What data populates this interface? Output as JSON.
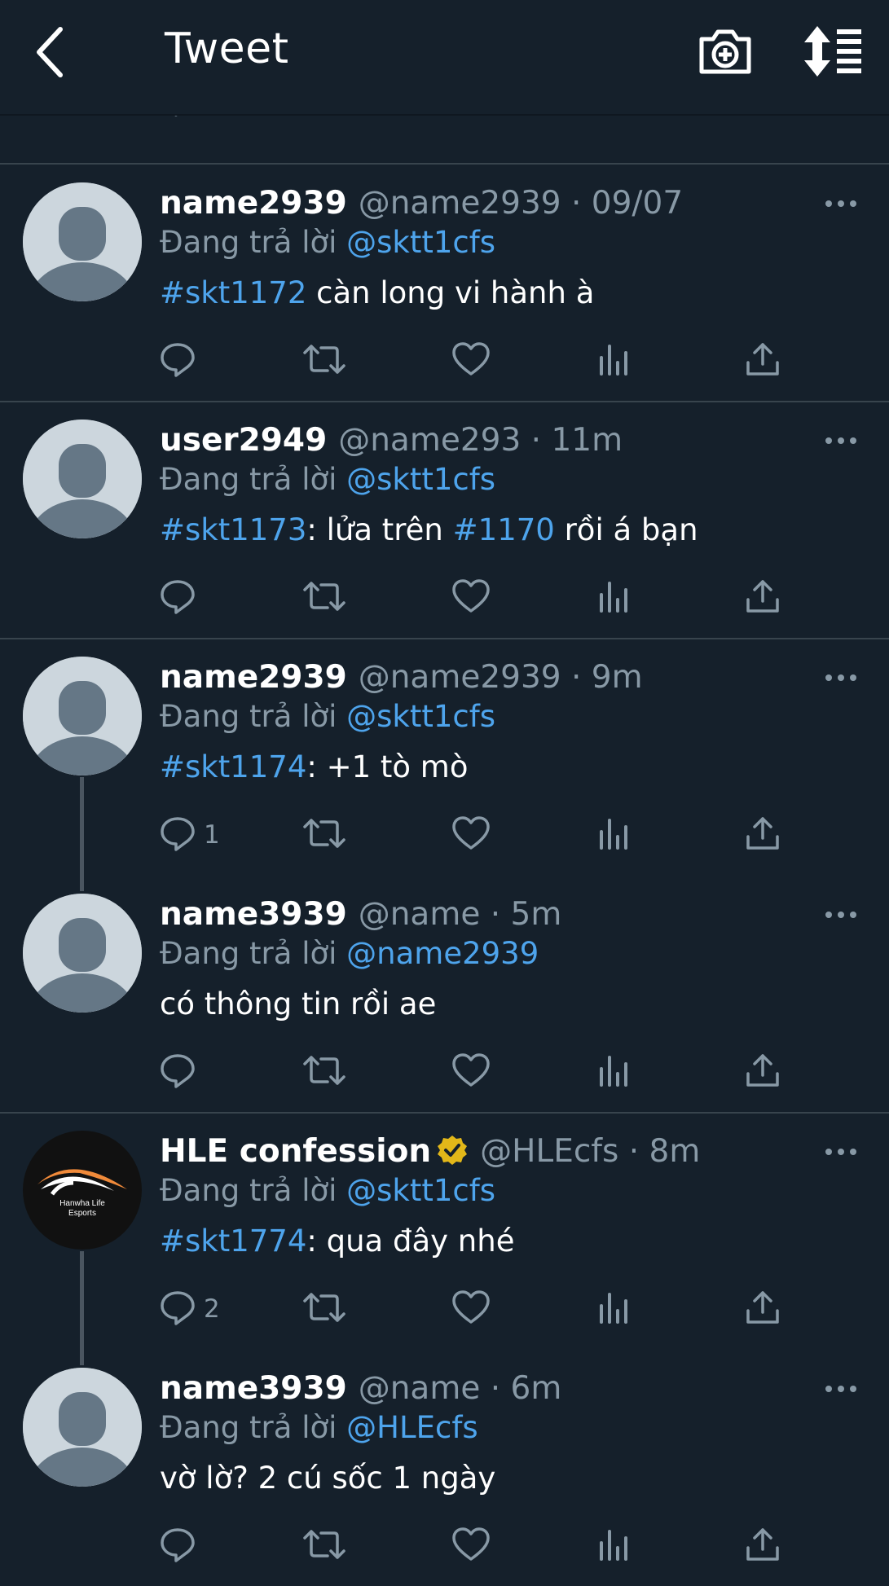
{
  "header": {
    "title": "Tweet"
  },
  "tweets": [
    {
      "name": "name2939",
      "handle": "@name2939 · 09/07",
      "reply_prefix": "Đang trả lời ",
      "reply_to": "@sktt1cfs",
      "body": [
        {
          "t": "tag",
          "v": "#skt1172"
        },
        {
          "t": "text",
          "v": " càn long vi hành à"
        }
      ],
      "reply_count": ""
    },
    {
      "name": "user2949",
      "handle": "@name293 · 11m",
      "reply_prefix": "Đang trả lời ",
      "reply_to": "@sktt1cfs",
      "body": [
        {
          "t": "tag",
          "v": "#skt1173"
        },
        {
          "t": "text",
          "v": ": lửa trên "
        },
        {
          "t": "tag",
          "v": "#1170"
        },
        {
          "t": "text",
          "v": " rồi á bạn"
        }
      ],
      "reply_count": ""
    },
    {
      "name": "name2939",
      "handle": "@name2939 · 9m",
      "reply_prefix": "Đang trả lời ",
      "reply_to": "@sktt1cfs",
      "body": [
        {
          "t": "tag",
          "v": "#skt1174"
        },
        {
          "t": "text",
          "v": ": +1 tò mò"
        }
      ],
      "reply_count": "1"
    },
    {
      "name": "name3939",
      "handle": "@name · 5m",
      "reply_prefix": "Đang trả lời ",
      "reply_to": "@name2939",
      "body": [
        {
          "t": "text",
          "v": "có thông tin rồi ae"
        }
      ],
      "reply_count": ""
    },
    {
      "name": "HLE confession",
      "handle": "@HLEcfs · 8m",
      "reply_prefix": "Đang trả lời ",
      "reply_to": "@sktt1cfs",
      "body": [
        {
          "t": "tag",
          "v": "#skt1774"
        },
        {
          "t": "text",
          "v": ": qua đây nhé"
        }
      ],
      "reply_count": "2",
      "verified": true,
      "logo_text": [
        "Hanwha Life",
        "Esports"
      ]
    },
    {
      "name": "name3939",
      "handle": "@name · 6m",
      "reply_prefix": "Đang trả lời ",
      "reply_to": "@HLEcfs",
      "body": [
        {
          "t": "text",
          "v": "vờ lờ? 2 cú sốc 1 ngày"
        }
      ],
      "reply_count": ""
    }
  ],
  "colors": {
    "background": "#15202b",
    "accent": "#4ea4ec",
    "muted": "#8899a6",
    "divider": "#38444d"
  }
}
